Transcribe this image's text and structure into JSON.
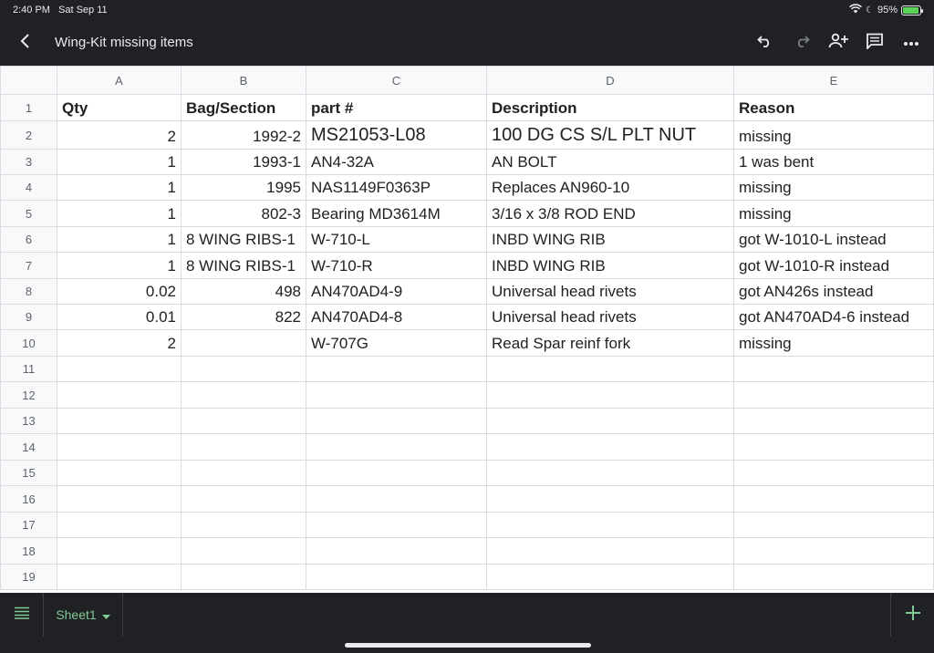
{
  "status": {
    "time": "2:40 PM",
    "date": "Sat Sep 11",
    "battery": "95%",
    "battery_level": 0.95
  },
  "toolbar": {
    "title": "Wing-Kit missing items"
  },
  "columns": [
    "A",
    "B",
    "C",
    "D",
    "E"
  ],
  "rows": [
    {
      "n": "1",
      "a": "Qty",
      "b": "Bag/Section",
      "c": "part #",
      "d": "Description",
      "e": "Reason"
    },
    {
      "n": "2",
      "a": "2",
      "b": "1992-2",
      "c": "MS21053-L08",
      "d": "100 DG CS S/L PLT NUT",
      "e": "missing"
    },
    {
      "n": "3",
      "a": "1",
      "b": "1993-1",
      "c": "AN4-32A",
      "d": "AN BOLT",
      "e": "1 was bent"
    },
    {
      "n": "4",
      "a": "1",
      "b": "1995",
      "c": "NAS1149F0363P",
      "d": "Replaces AN960-10",
      "e": "missing"
    },
    {
      "n": "5",
      "a": "1",
      "b": "802-3",
      "c": "Bearing MD3614M",
      "d": "3/16 x 3/8 ROD END",
      "e": "missing"
    },
    {
      "n": "6",
      "a": "1",
      "b": "8 WING RIBS-1",
      "c": "W-710-L",
      "d": "INBD WING RIB",
      "e": "got W-1010-L instead"
    },
    {
      "n": "7",
      "a": "1",
      "b": "8 WING RIBS-1",
      "c": "W-710-R",
      "d": "INBD WING RIB",
      "e": "got W-1010-R instead"
    },
    {
      "n": "8",
      "a": "0.02",
      "b": "498",
      "c": "AN470AD4-9",
      "d": "Universal head rivets",
      "e": "got AN426s instead"
    },
    {
      "n": "9",
      "a": "0.01",
      "b": "822",
      "c": "AN470AD4-8",
      "d": "Universal head rivets",
      "e": "got AN470AD4-6 instead"
    },
    {
      "n": "10",
      "a": "2",
      "b": "",
      "c": "W-707G",
      "d": "Read Spar reinf fork",
      "e": "missing"
    },
    {
      "n": "11",
      "a": "",
      "b": "",
      "c": "",
      "d": "",
      "e": ""
    },
    {
      "n": "12",
      "a": "",
      "b": "",
      "c": "",
      "d": "",
      "e": ""
    },
    {
      "n": "13",
      "a": "",
      "b": "",
      "c": "",
      "d": "",
      "e": ""
    },
    {
      "n": "14",
      "a": "",
      "b": "",
      "c": "",
      "d": "",
      "e": ""
    },
    {
      "n": "15",
      "a": "",
      "b": "",
      "c": "",
      "d": "",
      "e": ""
    },
    {
      "n": "16",
      "a": "",
      "b": "",
      "c": "",
      "d": "",
      "e": ""
    },
    {
      "n": "17",
      "a": "",
      "b": "",
      "c": "",
      "d": "",
      "e": ""
    },
    {
      "n": "18",
      "a": "",
      "b": "",
      "c": "",
      "d": "",
      "e": ""
    },
    {
      "n": "19",
      "a": "",
      "b": "",
      "c": "",
      "d": "",
      "e": ""
    }
  ],
  "sheets": [
    {
      "label": "Sheet1"
    }
  ],
  "colors": {
    "accent": "#81c995",
    "chrome": "#202124",
    "gridline": "#dadce0",
    "header_bg": "#f8f9fa"
  },
  "icons": [
    "back-icon",
    "undo-icon",
    "redo-icon",
    "share-icon",
    "comment-icon",
    "more-icon",
    "sheets-menu-icon",
    "dropdown-icon",
    "add-sheet-icon",
    "wifi-icon",
    "battery-icon"
  ]
}
